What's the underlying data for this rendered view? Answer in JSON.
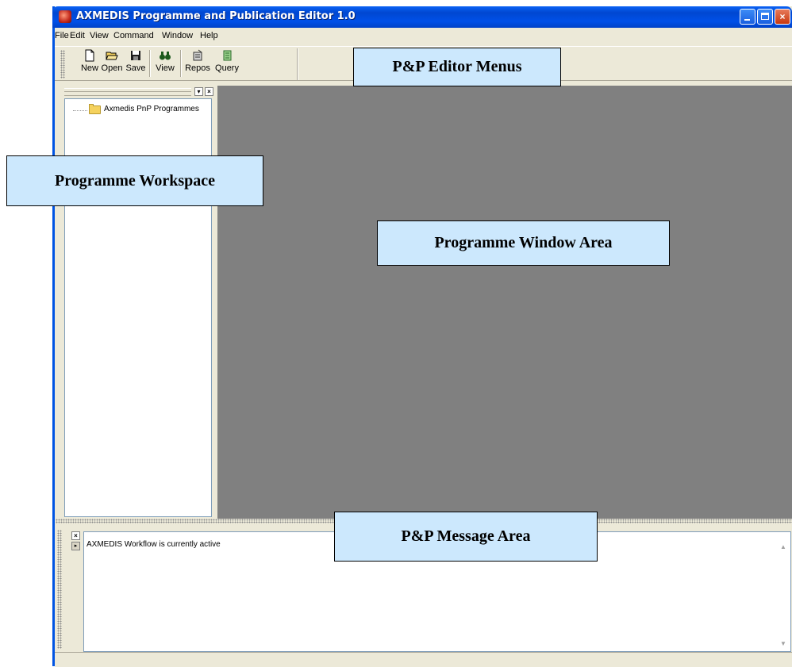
{
  "window": {
    "title": "AXMEDIS Programme and Publication Editor 1.0",
    "controls": {
      "minimize": "_",
      "maximize": "□",
      "close": "×"
    }
  },
  "menubar": {
    "items": [
      "File",
      "Edit",
      "View",
      "Command",
      "Window",
      "Help"
    ]
  },
  "toolbar": {
    "buttons": [
      {
        "label": "New",
        "icon": "new-document-icon"
      },
      {
        "label": "Open",
        "icon": "open-folder-icon"
      },
      {
        "label": "Save",
        "icon": "save-disk-icon"
      },
      {
        "label": "View",
        "icon": "binoculars-icon"
      },
      {
        "label": "Repos",
        "icon": "repository-icon"
      },
      {
        "label": "Query",
        "icon": "query-icon"
      }
    ]
  },
  "workspace": {
    "tree_root": "Axmedis PnP Programmes"
  },
  "message_area": {
    "lines": [
      "AXMEDIS Workflow is currently active"
    ]
  },
  "annotations": {
    "menus": "P&P Editor Menus",
    "workspace": "Programme Workspace",
    "window_area": "Programme Window Area",
    "message_area": "P&P Message Area"
  },
  "colors": {
    "titlebar": "#0050e8",
    "chrome": "#ece9d8",
    "mdi_background": "#808080",
    "callout_fill": "#cce8fd"
  }
}
